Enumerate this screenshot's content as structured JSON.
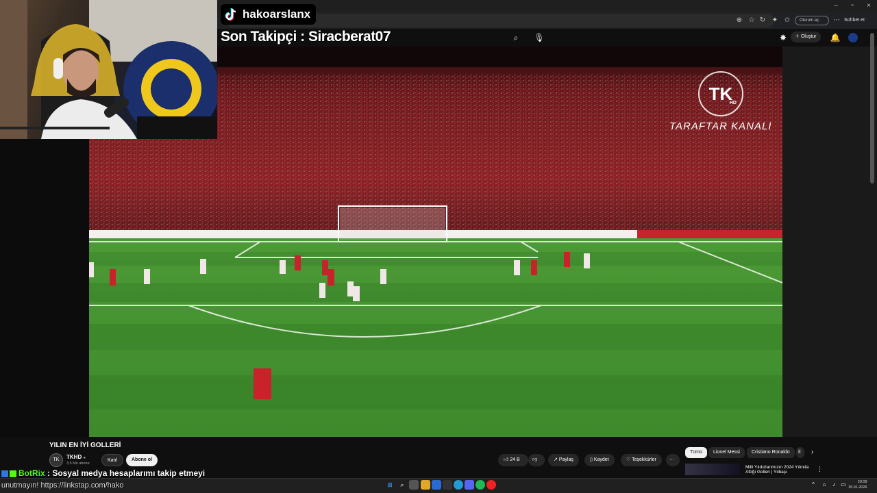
{
  "overlay": {
    "tiktok_name": "hakoarslanx",
    "follower_text": "Son Takipçi : Siracberat07"
  },
  "browser": {
    "window_controls": [
      "–",
      "▫",
      "×"
    ],
    "signin_label": "Oturum aç",
    "chat_label": "Sohbet et"
  },
  "youtube": {
    "create_label": "Oluştur"
  },
  "video": {
    "watermark_logo": "TK",
    "watermark_hd": "HD",
    "watermark_text": "TARAFTAR KANALI",
    "title": "YILIN EN İYİ GOLLERİ"
  },
  "channel": {
    "name": "TKHD",
    "avatar_text": "TK",
    "subscribers": "3,5 Mn abone",
    "join_label": "Katıl",
    "subscribe_label": "Abone ol"
  },
  "actions": {
    "likes": "24 B",
    "share": "Paylaş",
    "save": "Kaydet",
    "thanks": "Teşekkürler"
  },
  "chips": [
    "Tümü",
    "Lionel Messi",
    "Cristiano Ronaldo",
    "İl"
  ],
  "recommendation": {
    "title": "Milli Yıldızlarımızın 2024 Yılında",
    "subtitle": "Attığı Golleri | Yılbaşı"
  },
  "chat": {
    "user": "BotRix",
    "message": ": Sosyal medya hesaplarımı takip etmeyi",
    "line2": "unutmayın! https://linkstap.com/hako"
  },
  "clock": {
    "time": "20:09",
    "date": "15.01.2026"
  }
}
